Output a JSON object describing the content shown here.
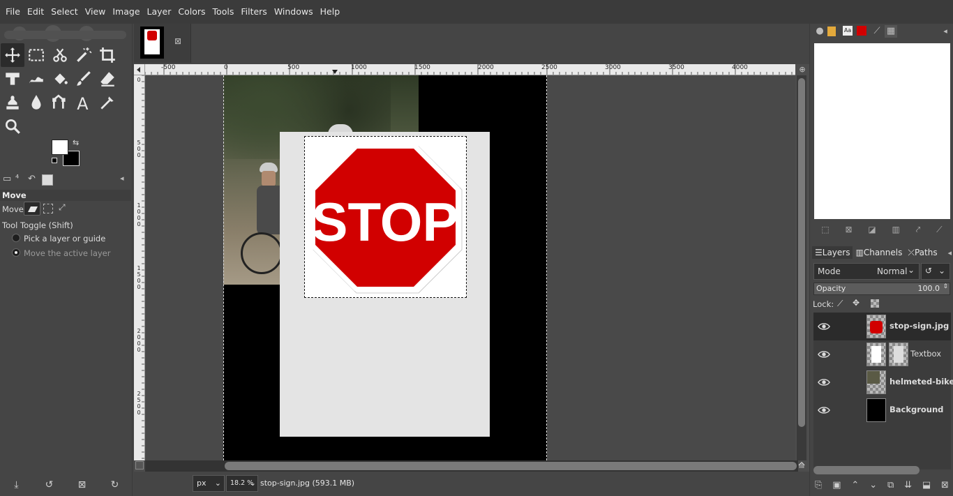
{
  "menubar": {
    "items": [
      "File",
      "Edit",
      "Select",
      "View",
      "Image",
      "Layer",
      "Colors",
      "Tools",
      "Filters",
      "Windows",
      "Help"
    ]
  },
  "toolbox": {
    "tools": [
      "move-tool-icon",
      "rect-select-icon",
      "fuzzy-select-icon",
      "magic-wand-icon",
      "crop-icon",
      "transform-icon",
      "warp-icon",
      "bucket-fill-icon",
      "paintbrush-icon",
      "eraser-icon",
      "clone-icon",
      "smudge-icon",
      "paths-icon",
      "text-tool-icon",
      "color-picker-icon",
      "zoom-tool-icon"
    ],
    "colors": {
      "foreground": "#ffffff",
      "background": "#000000"
    }
  },
  "tool_options": {
    "title": "Move",
    "move_label": "Move:",
    "toggle_label": "Tool Toggle  (Shift)",
    "options": [
      {
        "label": "Pick a layer or guide",
        "selected": false
      },
      {
        "label": "Move the active layer",
        "selected": true
      }
    ]
  },
  "canvas": {
    "ruler_h": [
      "-500",
      "0",
      "500",
      "1000",
      "1500",
      "2000",
      "2500",
      "3000",
      "3500",
      "4000"
    ],
    "ruler_v": [
      [
        "0"
      ],
      [
        "5",
        "0",
        "0"
      ],
      [
        "1",
        "0",
        "0",
        "0"
      ],
      [
        "1",
        "5",
        "0",
        "0"
      ],
      [
        "2",
        "0",
        "0",
        "0"
      ],
      [
        "2",
        "5",
        "0",
        "0"
      ]
    ],
    "stop_text": "STOP"
  },
  "status": {
    "unit": "px",
    "zoom": "18.2 %",
    "info": "stop-sign.jpg (593.1 MB)"
  },
  "dock": {
    "tabs": [
      "Layers",
      "Channels",
      "Paths"
    ],
    "mode_label": "Mode",
    "mode_value": "Normal",
    "opacity_label": "Opacity",
    "opacity_value": "100.0",
    "lock_label": "Lock:",
    "layers": [
      {
        "name": "stop-sign.jpg",
        "bold": true,
        "selected": true
      },
      {
        "name": "Textbox",
        "bold": false,
        "selected": false
      },
      {
        "name": "helmeted-biker",
        "bold": true,
        "selected": false
      },
      {
        "name": "Background",
        "bold": true,
        "selected": false
      }
    ]
  },
  "colors": {
    "stop_red": "#d10000",
    "selection": "#000000",
    "accent": "#ffffff"
  }
}
